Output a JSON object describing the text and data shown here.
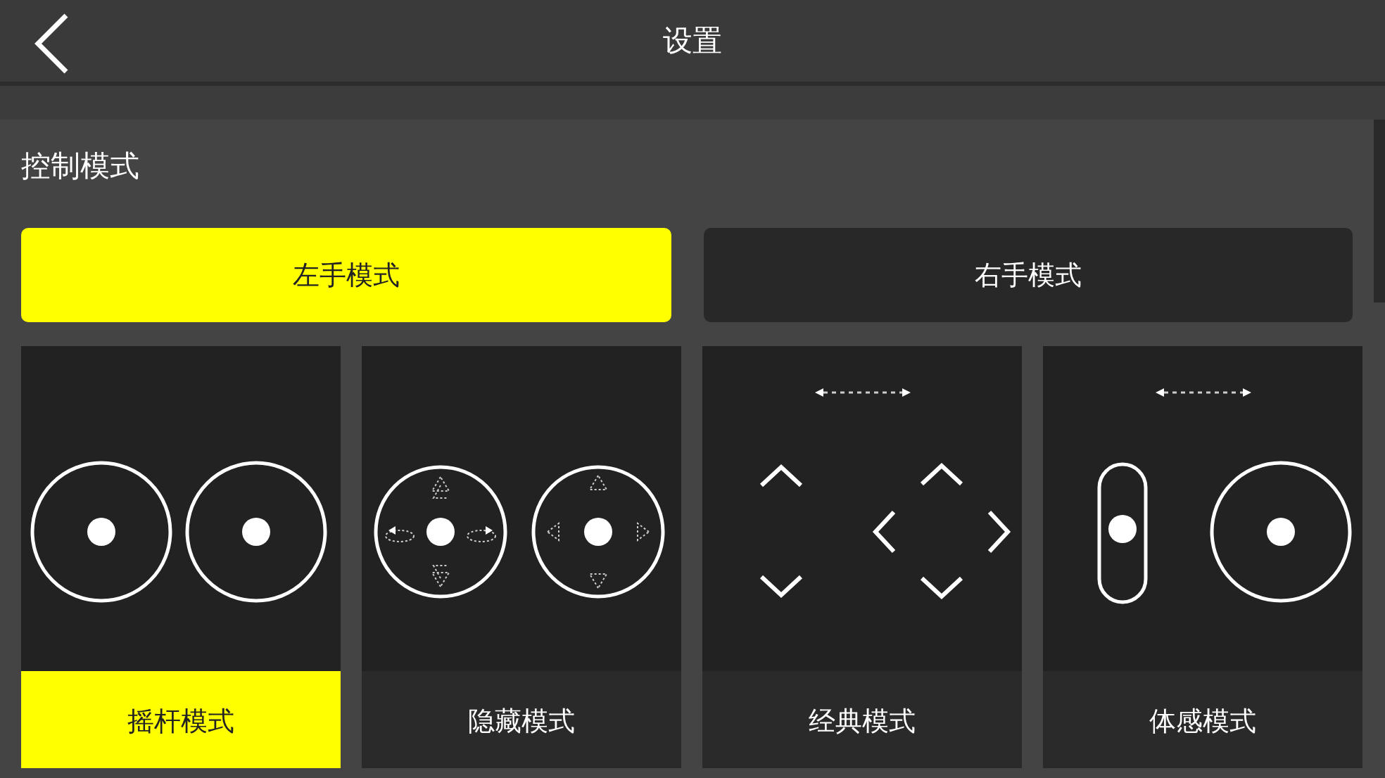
{
  "header": {
    "title": "设置"
  },
  "section": {
    "heading": "控制模式"
  },
  "hand_modes": [
    {
      "label": "左手模式",
      "selected": true
    },
    {
      "label": "右手模式",
      "selected": false
    }
  ],
  "control_modes": [
    {
      "kind": "joystick",
      "label": "摇杆模式",
      "selected": true
    },
    {
      "kind": "hidden",
      "label": "隐藏模式",
      "selected": false
    },
    {
      "kind": "classic",
      "label": "经典模式",
      "selected": false
    },
    {
      "kind": "motion",
      "label": "体感模式",
      "selected": false
    }
  ]
}
